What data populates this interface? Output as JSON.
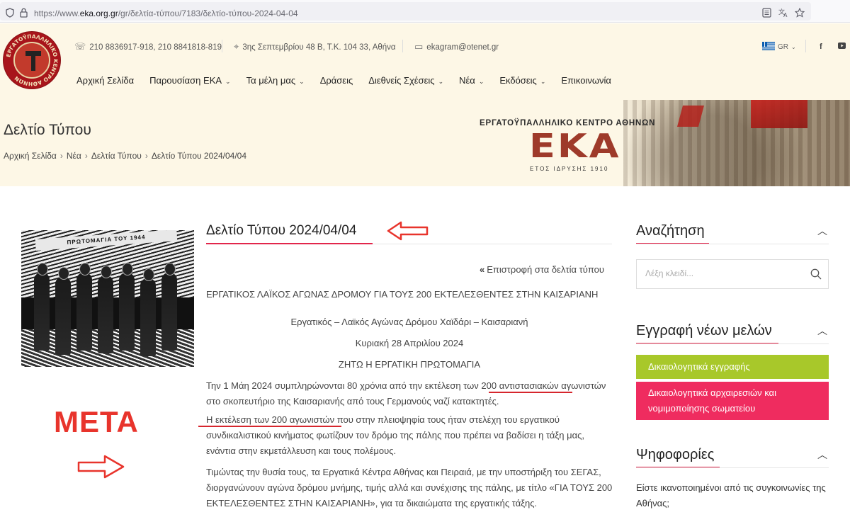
{
  "browser": {
    "url_prefix": "https://www.",
    "url_host": "eka.org.gr",
    "url_path": "/gr/δελτία-τύπου/7183/δελτίο-τύπου-2024-04-04"
  },
  "header": {
    "phone": "210 8836917-918, 210 8841818-819",
    "address": "3ης Σεπτεμβρίου 48 Β, Τ.Κ. 104 33, Αθήνα",
    "email": "ekagram@otenet.gr",
    "language": "GR",
    "logo_ring_text": "ΕΡΓΑΤΟΫΠΑΛΛΗΛΙΚΟ ΚΕΝΤΡΟ ΑΘΗΝΩΝ",
    "nav": [
      {
        "label": "Αρχική Σελίδα",
        "dropdown": false
      },
      {
        "label": "Παρουσίαση ΕΚΑ",
        "dropdown": true
      },
      {
        "label": "Τα μέλη μας",
        "dropdown": true
      },
      {
        "label": "Δράσεις",
        "dropdown": false
      },
      {
        "label": "Διεθνείς Σχέσεις",
        "dropdown": true
      },
      {
        "label": "Νέα",
        "dropdown": true
      },
      {
        "label": "Εκδόσεις",
        "dropdown": true
      },
      {
        "label": "Επικοινωνία",
        "dropdown": false
      }
    ],
    "page_title": "Δελτίο Τύπου",
    "breadcrumb": [
      "Αρχική Σελίδα",
      "Νέα",
      "Δελτία Τύπου",
      "Δελτίο Τύπου 2024/04/04"
    ],
    "banner": {
      "org_name": "ΕΡΓΑΤΟΫΠΑΛΛΗΛΙΚΟ ΚΕΝΤΡΟ ΑΘΗΝΩΝ",
      "acronym": "ΕΚΑ",
      "since": "ΕΤΟΣ ΙΔΡΥΣΗΣ 1910"
    }
  },
  "article": {
    "image_ribbon": "ΠΡΩΤΟΜΑΓΙΑ ΤΟΥ 1944",
    "title": "Δελτίο Τύπου 2024/04/04",
    "back_link": "Επιστροφή στα δελτία τύπου",
    "heading": "ΕΡΓΑΤΙΚΟΣ ΛΑΪΚΟΣ ΑΓΩΝΑΣ ΔΡΟΜΟΥ ΓΙΑ ΤΟΥΣ 200 ΕΚΤΕΛΕΣΘΕΝΤΕΣ ΣΤΗΝ ΚΑΙΣΑΡΙΑΝΗ",
    "center_lines": [
      "Εργατικός – Λαϊκός Αγώνας Δρόμου Χαϊδάρι – Καισαριανή",
      "Κυριακή 28 Απριλίου 2024",
      "ΖΗΤΩ Η ΕΡΓΑΤΙΚΗ ΠΡΩΤΟΜΑΓΙΑ"
    ],
    "paragraphs": [
      "Την 1 Μάη 2024 συμπληρώνονται 80 χρόνια από την εκτέλεση των 200 αντιστασιακών αγωνιστών στο σκοπευτήριο της Καισαριανής από τους Γερμανούς ναζί κατακτητές.",
      "Η εκτέλεση των 200 αγωνιστών που στην πλειοψηφία τους ήταν στελέχη του εργατικού συνδικαλιστικού κινήματος φωτίζουν τον δρόμο της πάλης που πρέπει να βαδίσει η τάξη μας, ενάντια στην εκμετάλλευση και τους πολέμους.",
      "Τιμώντας την θυσία τους, τα Εργατικά Κέντρα Αθήνας και Πειραιά, με την υποστήριξη του ΣΕΓΑΣ, διοργανώνουν αγώνα δρόμου μνήμης, τιμής αλλά και συνέχισης της πάλης, με τίτλο «ΓΙΑ ΤΟΥΣ 200 ΕΚΤΕΛΕΣΘΕΝΤΕΣ ΣΤΗΝ ΚΑΙΣΑΡΙΑΝΗ», για τα δικαιώματα της εργατικής τάξης."
    ]
  },
  "annotation": {
    "label": "ΜΕΤΑ",
    "color": "#e8342c"
  },
  "sidebar": {
    "search": {
      "title": "Αναζήτηση",
      "placeholder": "Λέξη κλειδί..."
    },
    "register": {
      "title": "Εγγραφή νέων μελών",
      "button_docs": "Δικαιολογητικά εγγραφής",
      "button_elections": "Δικαιολογητικά αρχαιρεσιών και νομιμοποίησης σωματείου"
    },
    "polls": {
      "title": "Ψηφοφορίες",
      "question": "Είστε ικανοποιημένοι από τις συγκοινωνίες της Αθήνας;"
    }
  },
  "colors": {
    "accent": "#e2264b",
    "green": "#a8c82a",
    "pink": "#ef2c5f",
    "header_bg": "#fdf7e6"
  }
}
